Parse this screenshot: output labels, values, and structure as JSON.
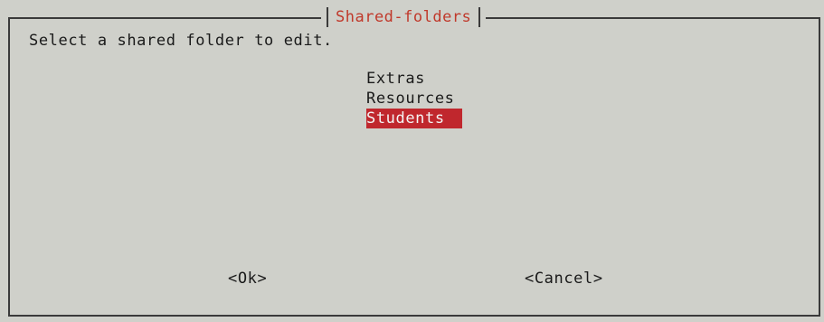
{
  "dialog": {
    "title": "Shared-folders",
    "prompt": "Select a shared folder to edit.",
    "items": [
      {
        "label": "Extras",
        "selected": false
      },
      {
        "label": "Resources",
        "selected": false
      },
      {
        "label": "Students",
        "selected": true
      }
    ],
    "buttons": {
      "ok_label": "<Ok>",
      "cancel_label": "<Cancel>"
    }
  },
  "colors": {
    "background": "#cfd0ca",
    "title": "#c0392b",
    "selection": "#c0272d"
  }
}
